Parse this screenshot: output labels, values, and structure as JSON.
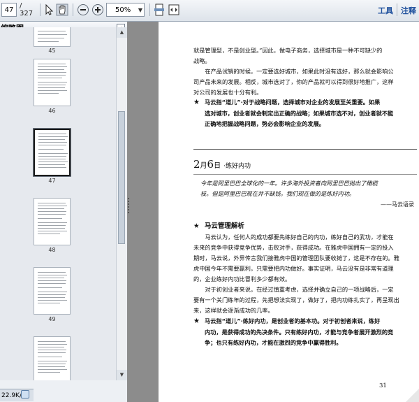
{
  "toolbar": {
    "page_current": "47",
    "page_total": "/ 327",
    "zoom": "50%",
    "tools_label": "工具",
    "comment_label": "注释"
  },
  "sidebar": {
    "title": "缩略图",
    "close_glyph": "◂",
    "thumbnails": [
      {
        "label": "45"
      },
      {
        "label": "46"
      },
      {
        "label": "47",
        "selected": true
      },
      {
        "label": "48"
      },
      {
        "label": "49"
      }
    ]
  },
  "status": {
    "text": "22.9K/s"
  },
  "document": {
    "intro_lines": [
      "就是管理型，不是创业型。”因此，做电子商务，选择城市是一种不可缺少的",
      "战略。",
      "　　在产品试销的时候，一定要选好城市，如果此时没有选好，那么就会影响公",
      "司产品未来的发展。相反，城市选对了，你的产品就可以得到很好地推广，这样",
      "对公司的发展也十分有利。"
    ],
    "star1_lines": [
      "马云指“道儿”·对于战略问题，选择城市对企业的发展至关重要。如果",
      "选对城市，创业者就会制定出正确的战略；如果城市选不对，创业者就不能",
      "正确地把握战略问题，势必会影响企业的发展。"
    ],
    "date_title": "2月6日",
    "date_day": "2",
    "date_month": "月",
    "date_num": "6",
    "date_suffix": "日",
    "date_topic": "·练好内功",
    "quote_lines": [
      "今年是阿里巴巴全球化的一年。许多海外投资者向阿里巴巴抛出了橄榄",
      "枝。但是阿里巴巴现在并不缺钱，我们现在做的是练好内功。"
    ],
    "quote_source": "——马云语录",
    "section_title": "马云管理解析",
    "body_lines": [
      "　　马云认为，任何人的成功都要先练好自己的内功，练好自己的武功，才能在",
      "未来的竞争中获得竞争优势，击败对手，获得成功。在雅虎中国拥有一定的投入",
      "期时，马云说，外界传言我们接雅虎中国的管理团队要收摊了，这是不存在的。雅",
      "虎中国今年不需要赢利，只需要把内功做好。事实证明，马云没有是非常有道理",
      "的，企业练好内功比冒利多少都有效。",
      "　　对于初创业者来说，在经过慎重考虑，选择并确立自己的一项战略后，一定",
      "要有一个关门练年的过程，先把想法实现了，做好了，把内功练扎实了，再呈现出",
      "来，这样就会逐渐成功的几率。"
    ],
    "star2_lines": [
      "马云指“道儿”·练好内功，是创业者的基本功。对于初创者来说，练好",
      "内功，是获得成功的先决条件。只有练好内功，才能与竞争者展开激烈的竞",
      "争；也只有练好内功，才能在激烈的竞争中赢得胜利。"
    ],
    "page_number": "31"
  },
  "colors": {
    "toolbar_bg": "#dde3ea",
    "link_blue": "#1d4f9c",
    "doc_bg": "#8c8c8c"
  }
}
